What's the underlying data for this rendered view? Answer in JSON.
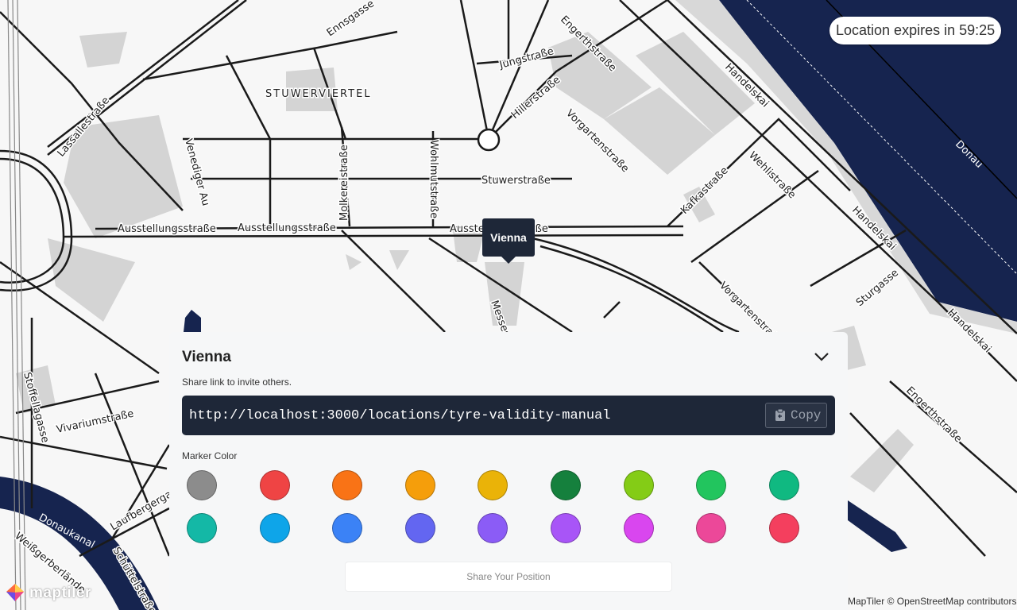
{
  "map": {
    "district": "STUWERVIERTEL",
    "streets": {
      "handelskai": "Handelskai",
      "engerthstrasse": "Engerthstraße",
      "vorgartenstrasse": "Vorgartenstraße",
      "ausstellungsstrasse": "Ausstellungsstraße",
      "stuwerstrasse": "Stuwerstraße",
      "molkereistrasse": "Molkereistraße",
      "wohlmutstrasse": "Wohlmutstraße",
      "venediger_au": "Venediger Au",
      "lassallestrasse": "Lassallestraße",
      "ennsgasse": "Ennsgasse",
      "jungstrasse": "Jungstraße",
      "hillerstrasse": "Hillerstraße",
      "wehlistrasse": "Wehlistraße",
      "kafkastrasse": "Kafkastraße",
      "sturgasse": "Sturgasse",
      "vivariumstrasse": "Vivariumstraße",
      "stoffellagasse": "Stoffellagasse",
      "laufbergergasse": "Laufbergergasse",
      "weissgerberlaende": "Weißgerberlände",
      "schuettelstrasse": "Schüttelstraße",
      "messestrasse": "Messestraße",
      "donau": "Donau",
      "donaukanal": "Donaukanal"
    }
  },
  "marker": {
    "label": "Vienna",
    "color": "#1e2738"
  },
  "expiry": {
    "text": "Location expires in 59:25"
  },
  "panel": {
    "title": "Vienna",
    "subtitle": "Share link to invite others.",
    "url": "http://localhost:3000/locations/tyre-validity-manual",
    "copy_label": "Copy",
    "copy_icon": "clipboard-icon",
    "collapse_icon": "chevron-down-icon",
    "marker_color_label": "Marker Color",
    "colors": [
      "#8c8c8c",
      "#ef4444",
      "#f97316",
      "#f59e0b",
      "#eab308",
      "#15803d",
      "#84cc16",
      "#22c55e",
      "#10b981",
      "#14b8a6",
      "#0ea5e9",
      "#3b82f6",
      "#6366f1",
      "#8b5cf6",
      "#a855f7",
      "#d946ef",
      "#ec4899",
      "#f43f5e"
    ],
    "share_button": "Share Your Position"
  },
  "attribution": {
    "text": "MapTiler © OpenStreetMap contributors",
    "logo_text": "maptiler"
  },
  "theme": {
    "water": "#16244f",
    "building": "#d4d4d4",
    "road": "#1a1a1a",
    "land": "#f7f7f7"
  }
}
